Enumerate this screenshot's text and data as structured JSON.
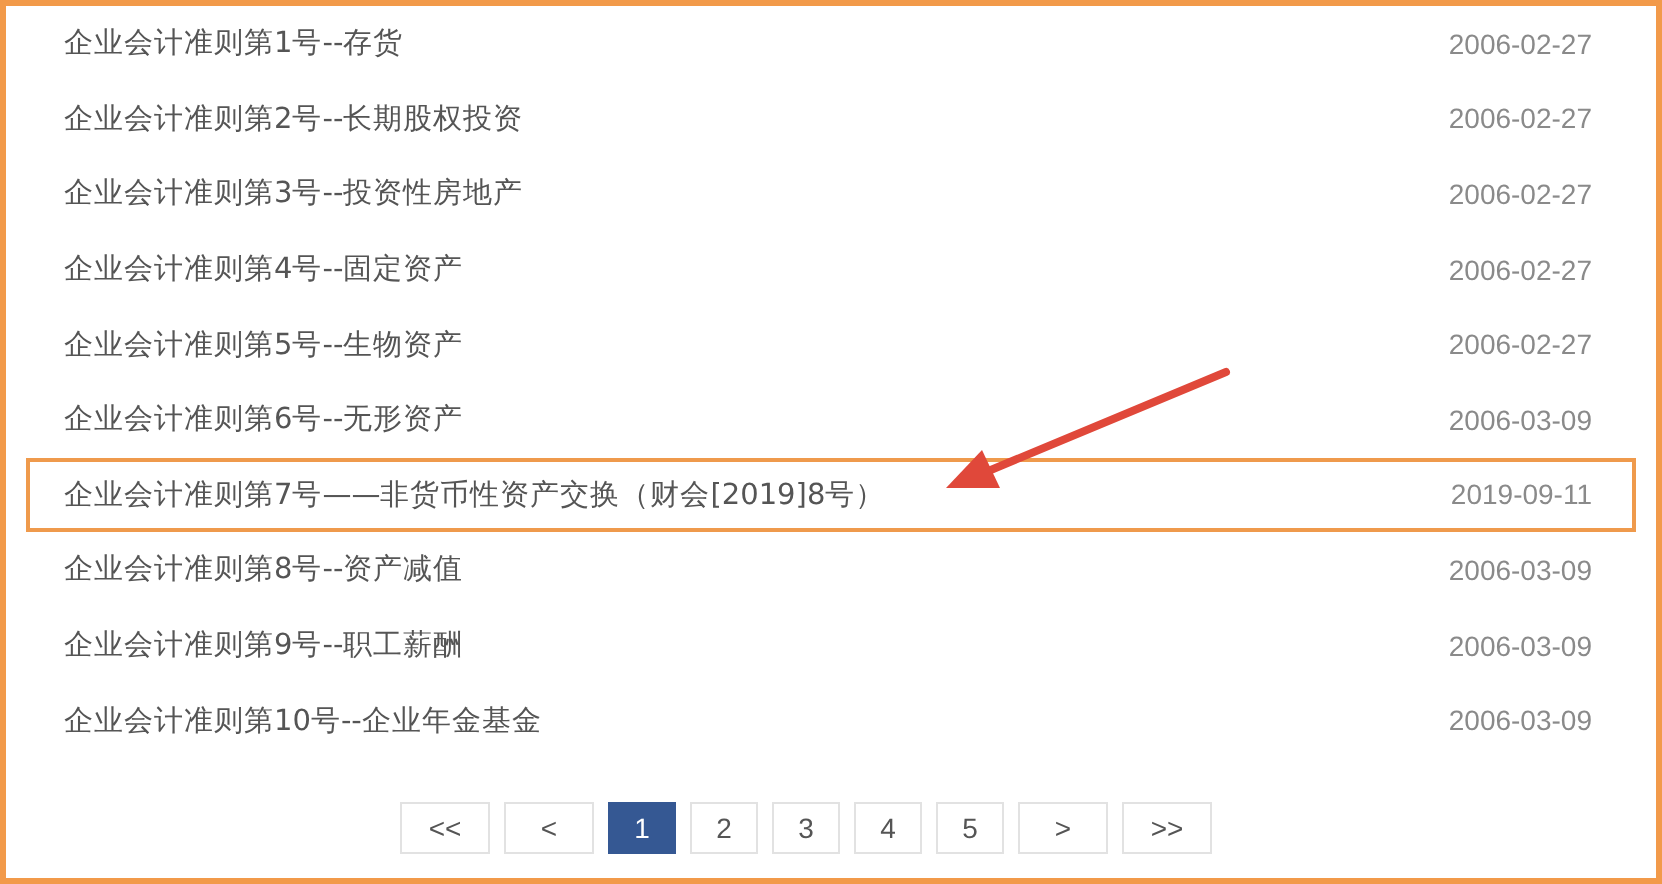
{
  "rows": [
    {
      "title": "企业会计准则第1号--存货",
      "date": "2006-02-27",
      "highlighted": false
    },
    {
      "title": "企业会计准则第2号--长期股权投资",
      "date": "2006-02-27",
      "highlighted": false
    },
    {
      "title": "企业会计准则第3号--投资性房地产",
      "date": "2006-02-27",
      "highlighted": false
    },
    {
      "title": "企业会计准则第4号--固定资产",
      "date": "2006-02-27",
      "highlighted": false
    },
    {
      "title": "企业会计准则第5号--生物资产",
      "date": "2006-02-27",
      "highlighted": false
    },
    {
      "title": "企业会计准则第6号--无形资产",
      "date": "2006-03-09",
      "highlighted": false
    },
    {
      "title": "企业会计准则第7号——非货币性资产交换（财会[2019]8号）",
      "date": "2019-09-11",
      "highlighted": true
    },
    {
      "title": "企业会计准则第8号--资产减值",
      "date": "2006-03-09",
      "highlighted": false
    },
    {
      "title": "企业会计准则第9号--职工薪酬",
      "date": "2006-03-09",
      "highlighted": false
    },
    {
      "title": "企业会计准则第10号--企业年金基金",
      "date": "2006-03-09",
      "highlighted": false
    }
  ],
  "pagination": [
    {
      "label": "<<",
      "selected": false,
      "kind": "nav"
    },
    {
      "label": "<",
      "selected": false,
      "kind": "nav"
    },
    {
      "label": "1",
      "selected": true,
      "kind": "page"
    },
    {
      "label": "2",
      "selected": false,
      "kind": "page"
    },
    {
      "label": "3",
      "selected": false,
      "kind": "page"
    },
    {
      "label": "4",
      "selected": false,
      "kind": "page"
    },
    {
      "label": "5",
      "selected": false,
      "kind": "page"
    },
    {
      "label": ">",
      "selected": false,
      "kind": "nav"
    },
    {
      "label": ">>",
      "selected": false,
      "kind": "nav"
    }
  ]
}
